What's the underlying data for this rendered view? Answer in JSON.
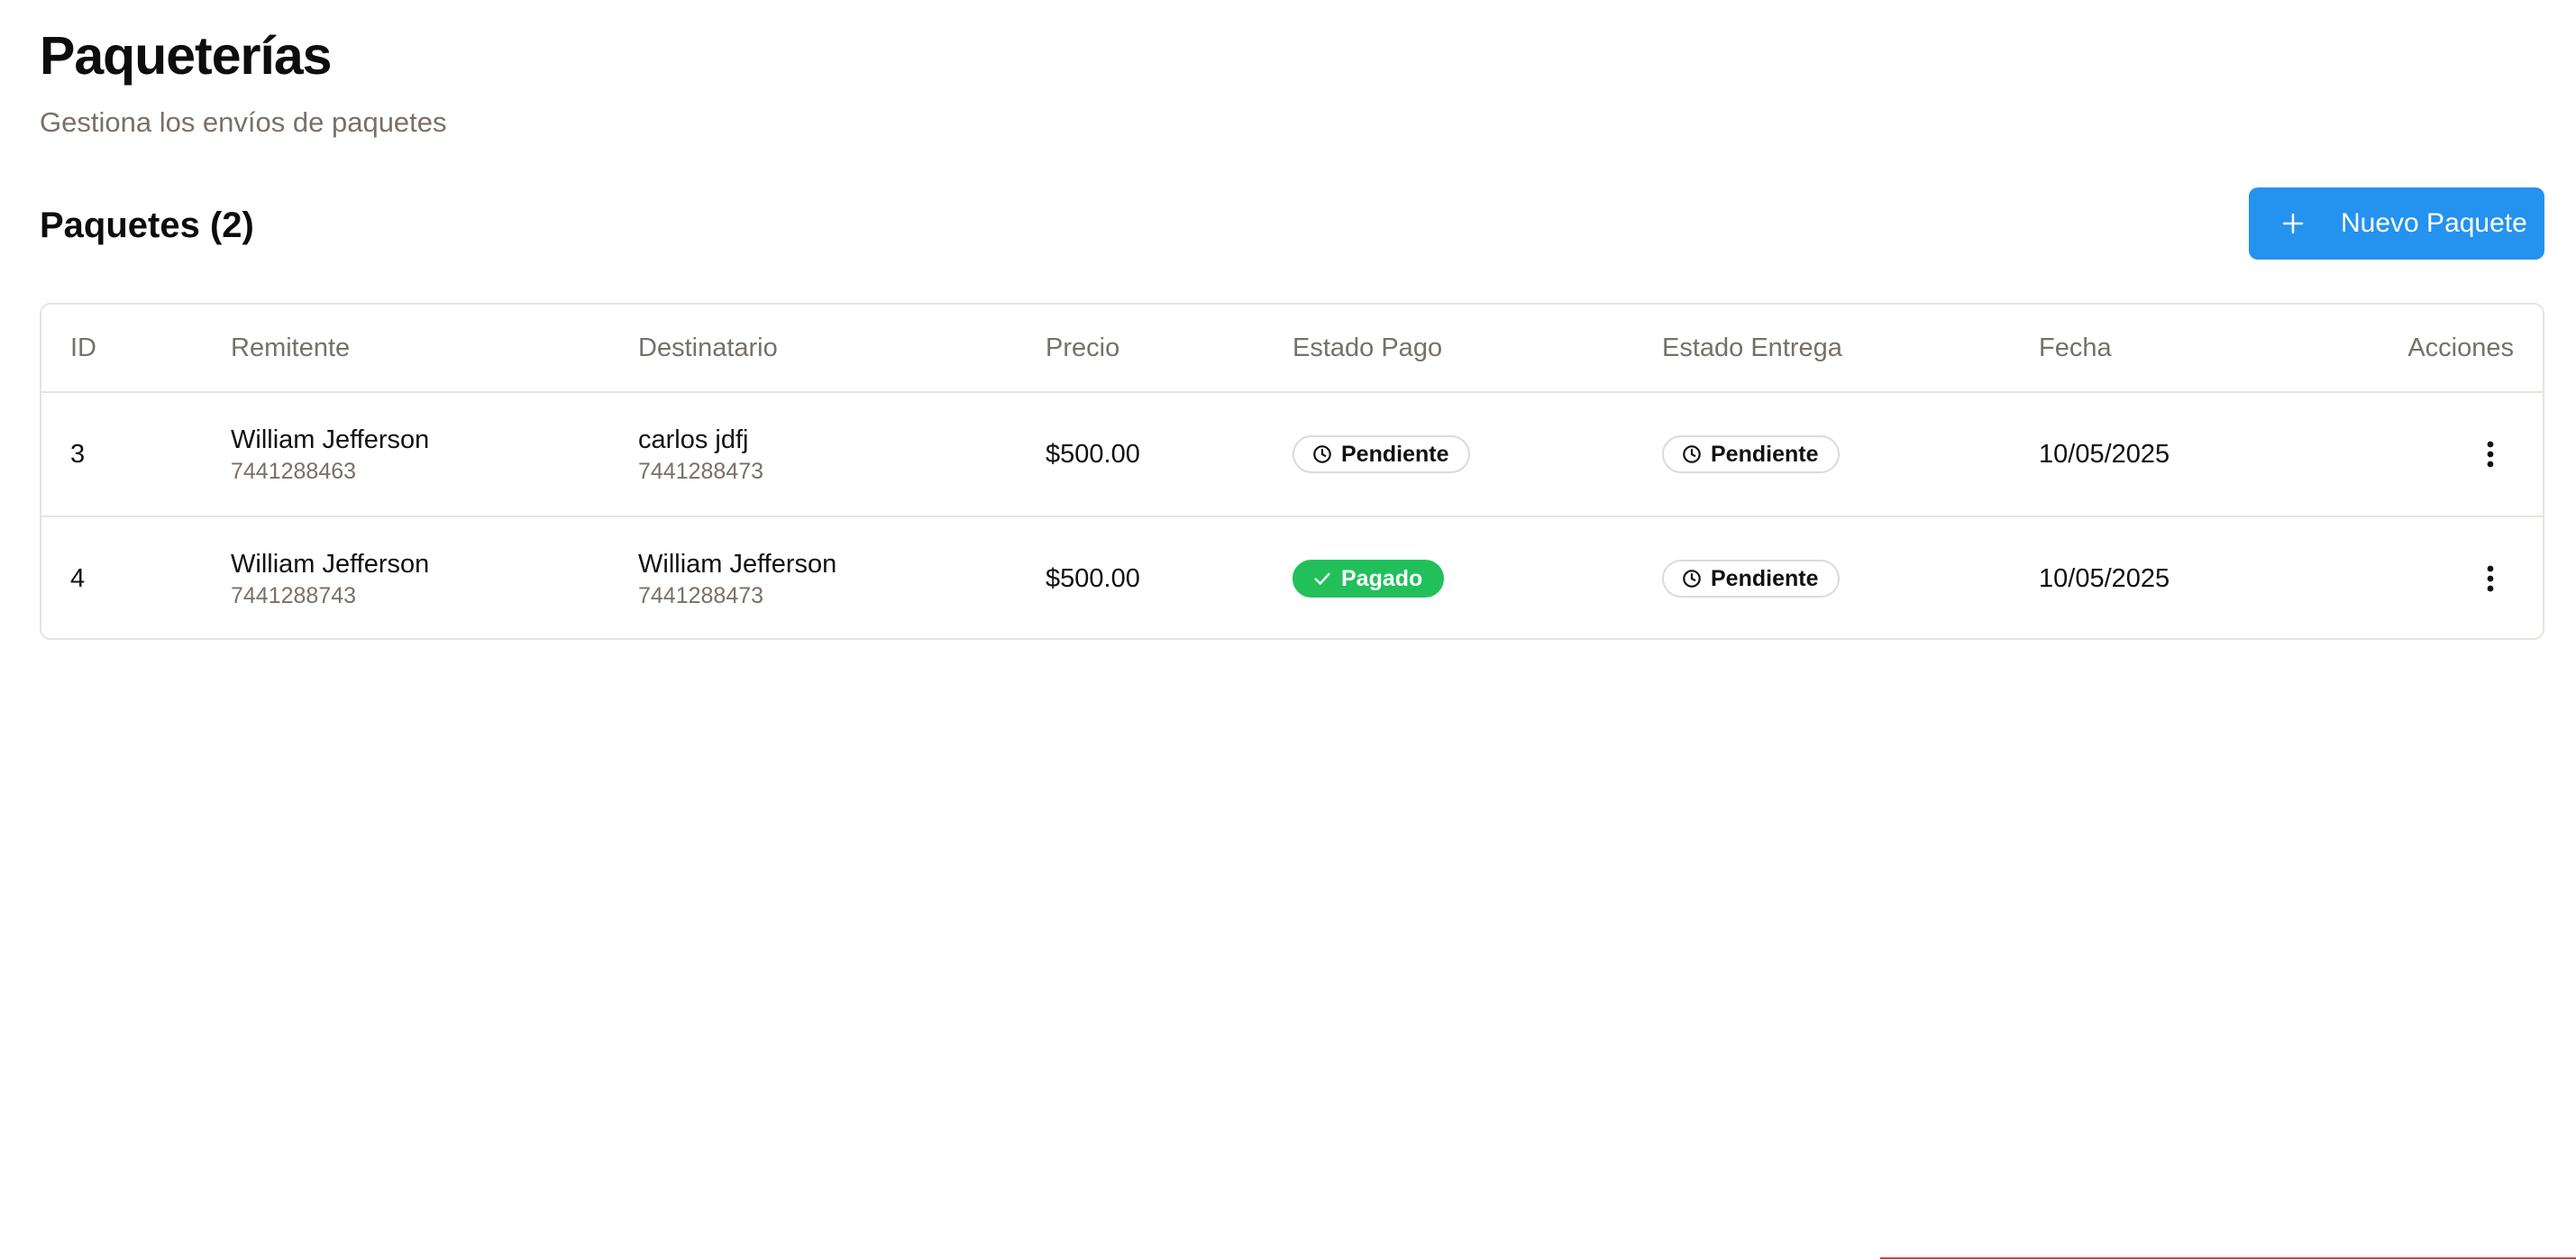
{
  "header": {
    "title": "Paqueterías",
    "subtitle": "Gestiona los envíos de paquetes"
  },
  "section": {
    "title": "Paquetes (2)",
    "new_button_label": "Nuevo Paquete",
    "new_button_icon": "plus-icon"
  },
  "colors": {
    "primary": "#2492ef",
    "paid": "#21c05b",
    "muted_text": "#7a7069",
    "border": "#e6e3df"
  },
  "table": {
    "columns": [
      "ID",
      "Remitente",
      "Destinatario",
      "Precio",
      "Estado Pago",
      "Estado Entrega",
      "Fecha",
      "Acciones"
    ],
    "rows": [
      {
        "id": "3",
        "sender_name": "William Jefferson",
        "sender_phone": "7441288463",
        "recipient_name": "carlos jdfj",
        "recipient_phone": "7441288473",
        "price": "$500.00",
        "payment_status": "Pendiente",
        "payment_icon": "clock-icon",
        "delivery_status": "Pendiente",
        "delivery_icon": "clock-icon",
        "date": "10/05/2025",
        "actions_icon": "more-vertical-icon"
      },
      {
        "id": "4",
        "sender_name": "William Jefferson",
        "sender_phone": "7441288743",
        "recipient_name": "William Jefferson",
        "recipient_phone": "7441288473",
        "price": "$500.00",
        "payment_status": "Pagado",
        "payment_icon": "check-icon",
        "delivery_status": "Pendiente",
        "delivery_icon": "clock-icon",
        "date": "10/05/2025",
        "actions_icon": "more-vertical-icon"
      }
    ]
  }
}
